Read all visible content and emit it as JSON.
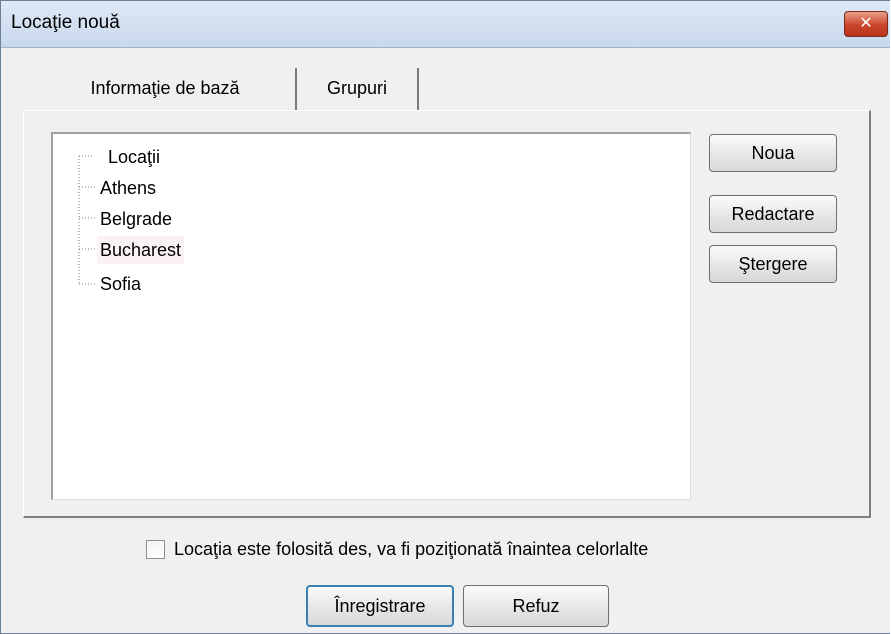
{
  "window": {
    "title": "Locaţie nouă",
    "close_glyph": "✕"
  },
  "tabs": [
    {
      "label": "Informaţie de bază",
      "active": true
    },
    {
      "label": "Grupuri",
      "active": false
    }
  ],
  "tree": {
    "root": "Locaţii",
    "children": [
      "Athens",
      "Belgrade",
      "Bucharest",
      "Sofia"
    ],
    "selected": "Bucharest"
  },
  "side_buttons": {
    "new": "Noua",
    "edit": "Redactare",
    "delete": "Ştergere"
  },
  "checkbox": {
    "label": "Locaţia este folosită des, va fi poziţionată înaintea celorlalte",
    "checked": false
  },
  "footer_buttons": {
    "save": "Înregistrare",
    "cancel": "Refuz"
  },
  "colors": {
    "close_button": "#c9452a",
    "default_button_border": "#3c7fb1",
    "selected_row": "#fbf3f3"
  }
}
